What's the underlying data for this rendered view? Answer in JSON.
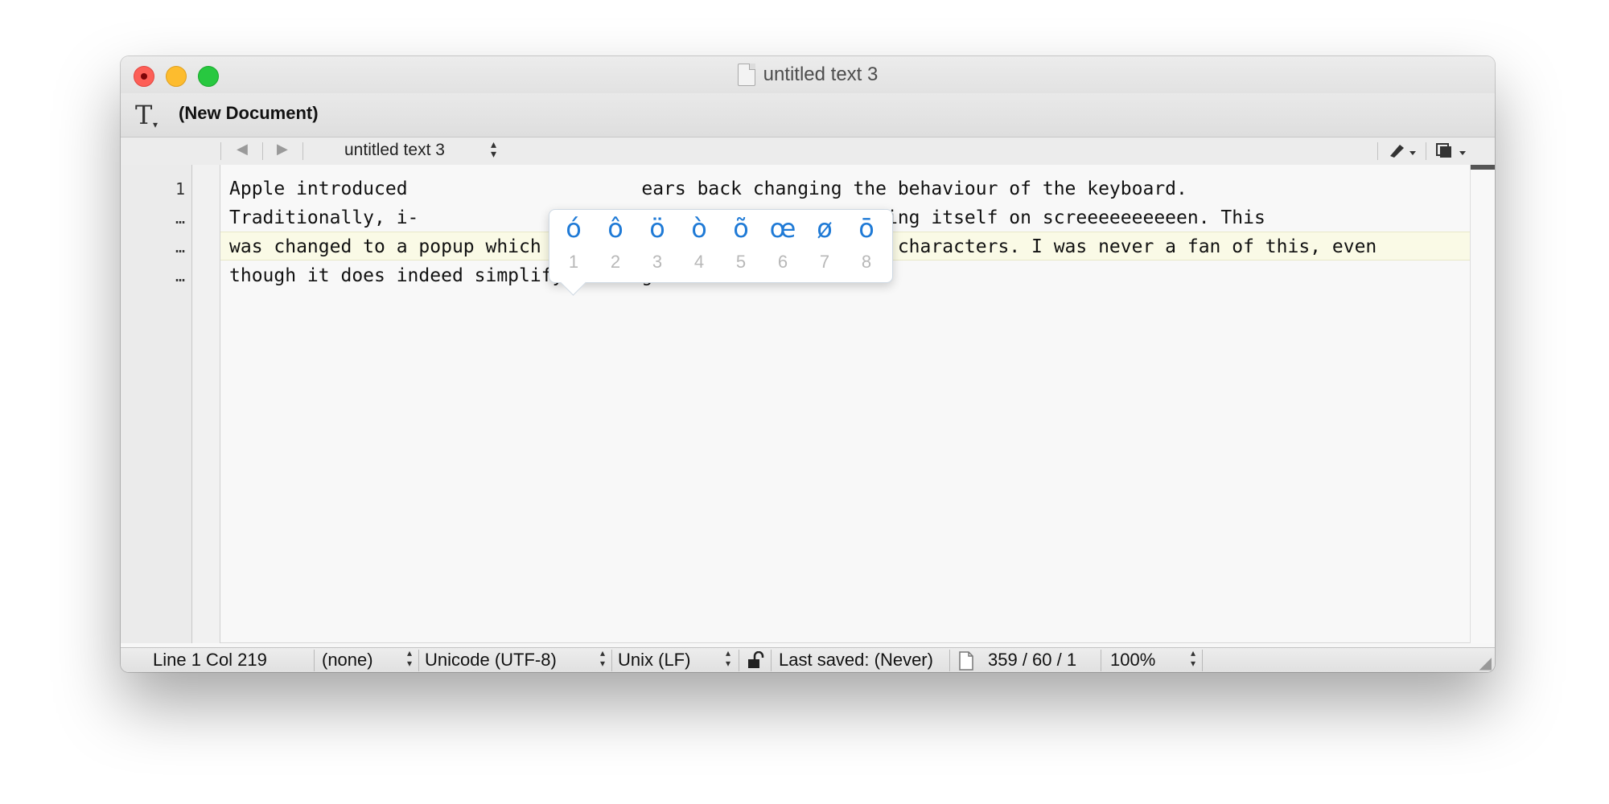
{
  "window": {
    "title": "untitled text 3"
  },
  "toolbar": {
    "document_label": "(New Document)",
    "text_tool_icon": "T"
  },
  "navbar": {
    "back_icon": "◀",
    "forward_icon": "▶",
    "file_menu": "untitled text 3",
    "pen_icon": "pen-icon",
    "copy_icon": "copy-icon"
  },
  "gutter": {
    "lines": [
      "1",
      "…",
      "…",
      "…"
    ]
  },
  "editor": {
    "lines": [
      "Apple introduced                     ears back changing the behaviour of the keyboard.",
      "Traditionally, i-                    ter would start repeating itself on screeeeeeeeeen. This",
      "was changed to a popup which displayed various non-standard characters. I was never a fan of this, even",
      "though it does indeed simplify finding accented letters."
    ]
  },
  "accent_popup": {
    "characters": [
      "ó",
      "ô",
      "ö",
      "ò",
      "õ",
      "œ",
      "ø",
      "ō"
    ],
    "numbers": [
      "1",
      "2",
      "3",
      "4",
      "5",
      "6",
      "7",
      "8"
    ]
  },
  "status": {
    "position": "Line 1 Col 219",
    "syntax": "(none)",
    "encoding": "Unicode (UTF-8)",
    "line_endings": "Unix (LF)",
    "saved": "Last saved: (Never)",
    "counts": "359 / 60 / 1",
    "zoom": "100%"
  },
  "colors": {
    "accent": "#1f7ad6",
    "current_line": "#fafae6"
  }
}
